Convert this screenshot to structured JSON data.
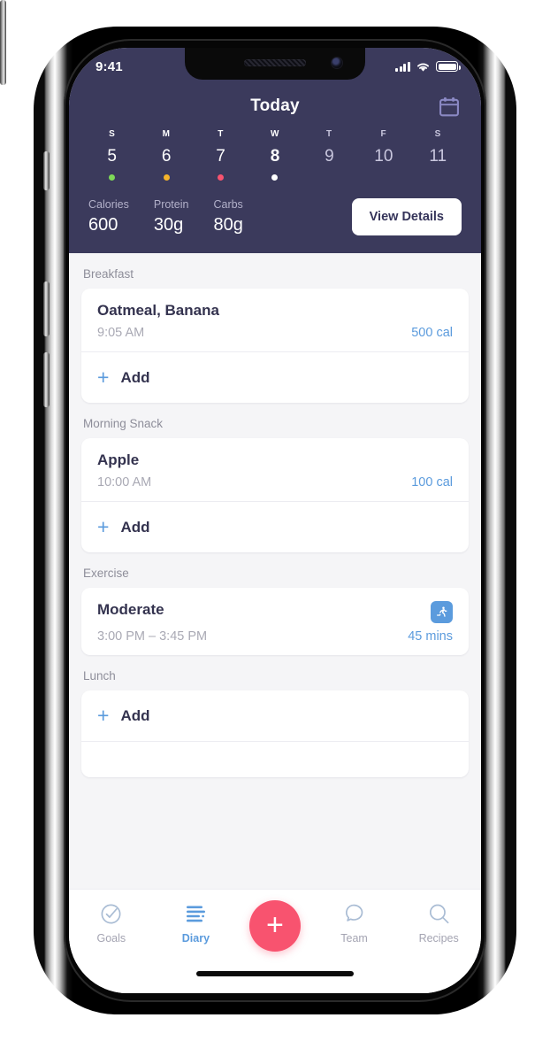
{
  "status_bar": {
    "time": "9:41",
    "cellular_icon": "signal-bars-icon",
    "wifi_icon": "wifi-icon",
    "battery_icon": "battery-icon"
  },
  "header": {
    "title": "Today",
    "calendar_icon": "calendar-icon",
    "accent_bg": "#3b3a5c",
    "week": [
      {
        "dow": "S",
        "num": "5",
        "dot": "#7ed957",
        "state": "past"
      },
      {
        "dow": "M",
        "num": "6",
        "dot": "#f5b32b",
        "state": "past"
      },
      {
        "dow": "T",
        "num": "7",
        "dot": "#f8536f",
        "state": "past"
      },
      {
        "dow": "W",
        "num": "8",
        "dot": "#ffffff",
        "state": "today"
      },
      {
        "dow": "T",
        "num": "9",
        "dot": "",
        "state": "future"
      },
      {
        "dow": "F",
        "num": "10",
        "dot": "",
        "state": "future"
      },
      {
        "dow": "S",
        "num": "11",
        "dot": "",
        "state": "future"
      }
    ]
  },
  "stats": {
    "items": [
      {
        "label": "Calories",
        "value": "600"
      },
      {
        "label": "Protein",
        "value": "30g"
      },
      {
        "label": "Carbs",
        "value": "80g"
      }
    ],
    "button_label": "View Details"
  },
  "sections": [
    {
      "title": "Breakfast",
      "entry": {
        "name": "Oatmeal, Banana",
        "time": "9:05 AM",
        "value": "500 cal"
      },
      "add_label": "Add",
      "add_icon": "plus-icon"
    },
    {
      "title": "Morning Snack",
      "entry": {
        "name": "Apple",
        "time": "10:00 AM",
        "value": "100 cal"
      },
      "add_label": "Add",
      "add_icon": "plus-icon"
    },
    {
      "title": "Exercise",
      "entry": {
        "name": "Moderate",
        "time": "3:00 PM – 3:45 PM",
        "value": "45 mins",
        "badge_icon": "running-person-icon"
      }
    },
    {
      "title": "Lunch",
      "add_label": "Add",
      "add_icon": "plus-icon"
    }
  ],
  "tabbar": {
    "tabs": [
      {
        "label": "Goals",
        "icon": "check-circle-icon",
        "active": false
      },
      {
        "label": "Diary",
        "icon": "list-lines-icon",
        "active": true
      },
      {
        "label": "Team",
        "icon": "speech-bubble-icon",
        "active": false
      },
      {
        "label": "Recipes",
        "icon": "search-icon",
        "active": false
      }
    ],
    "fab_icon": "plus-icon",
    "fab_color": "#f8536f",
    "active_color": "#5b9bdd"
  },
  "colors": {
    "navy": "#3b3a5c",
    "accent_blue": "#5b9bdd",
    "pink": "#f8536f",
    "page_bg": "#f5f5f7",
    "text_dark": "#34334f",
    "text_muted": "#a9a9b4"
  }
}
